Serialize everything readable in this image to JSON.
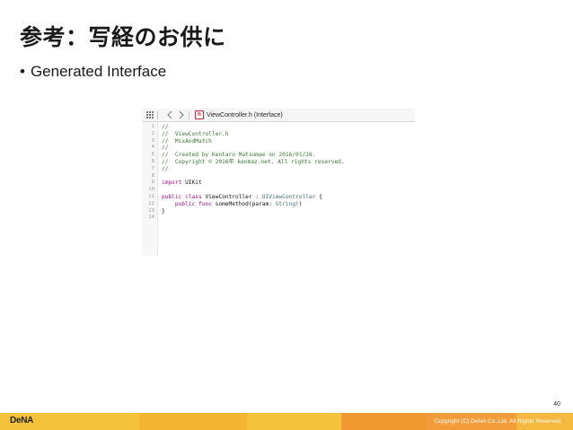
{
  "slide": {
    "title": "参考：写経のお供に",
    "bullet": "Generated Interface",
    "page_number": "40",
    "copyright": "Copyright (C) DeNA Co.,Ltd. All Rights Reserved.",
    "logo_text": "DeNA"
  },
  "editor": {
    "jumpbar": {
      "grid_icon": "grid-icon",
      "back_icon": "chevron-left-icon",
      "forward_icon": "chevron-right-icon",
      "file_badge": "h",
      "file_label": "ViewController.h (Interface)"
    },
    "lines": [
      {
        "n": "1",
        "text": "//",
        "kind": "comment"
      },
      {
        "n": "2",
        "text": "//  ViewController.h",
        "kind": "comment"
      },
      {
        "n": "3",
        "text": "//  MixAndMatch",
        "kind": "comment"
      },
      {
        "n": "4",
        "text": "//",
        "kind": "comment"
      },
      {
        "n": "5",
        "text": "//  Created by Kentaro Matsumae on 2016/01/26.",
        "kind": "comment"
      },
      {
        "n": "6",
        "text": "//  Copyright © 2016年 kenmaz.net. All rights reserved.",
        "kind": "comment"
      },
      {
        "n": "7",
        "text": "//",
        "kind": "comment"
      },
      {
        "n": "8",
        "text": "",
        "kind": "plain"
      },
      {
        "n": "9",
        "text": "import UIKit",
        "kind": "import"
      },
      {
        "n": "10",
        "text": "",
        "kind": "plain"
      },
      {
        "n": "11",
        "text": "public class ViewController : UIViewController {",
        "kind": "class"
      },
      {
        "n": "12",
        "text": "    public func someMethod(param: String!)",
        "kind": "func"
      },
      {
        "n": "13",
        "text": "}",
        "kind": "plain"
      },
      {
        "n": "14",
        "text": "",
        "kind": "plain"
      }
    ]
  },
  "colors": {
    "footer": [
      "#f5c23c",
      "#f3b431",
      "#f5c23c",
      "#f19a32",
      "#f39d3a",
      "#f6b940"
    ],
    "comment": "#3a7a32",
    "keyword": "#aa0d91"
  }
}
